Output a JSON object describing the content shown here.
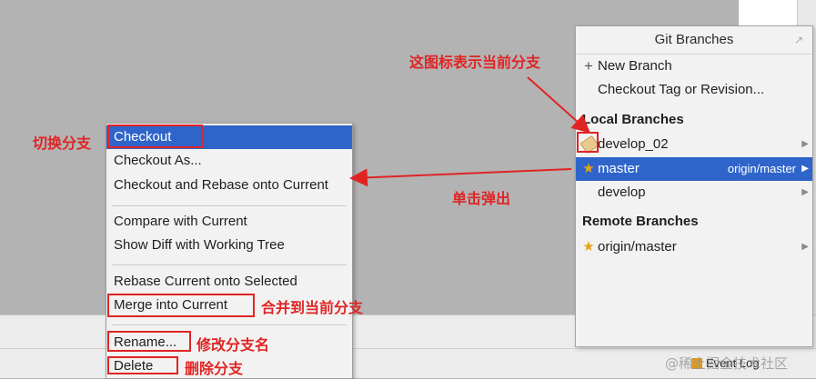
{
  "context_menu": {
    "items": [
      {
        "label": "Checkout"
      },
      {
        "label": "Checkout As..."
      },
      {
        "label": "Checkout and Rebase onto Current"
      },
      {
        "label": "Compare with Current"
      },
      {
        "label": "Show Diff with Working Tree"
      },
      {
        "label": "Rebase Current onto Selected"
      },
      {
        "label": "Merge into Current"
      },
      {
        "label": "Rename..."
      },
      {
        "label": "Delete"
      }
    ]
  },
  "git_branches": {
    "title": "Git Branches",
    "new_branch": "New Branch",
    "checkout_tag": "Checkout Tag or Revision...",
    "local_header": "Local Branches",
    "local": [
      {
        "name": "develop_02",
        "icon": "tag-icon"
      },
      {
        "name": "master",
        "icon": "star-icon",
        "tracking": "origin/master"
      },
      {
        "name": "develop"
      }
    ],
    "remote_header": "Remote Branches",
    "remote": [
      {
        "name": "origin/master",
        "icon": "star-icon"
      }
    ]
  },
  "annotations": {
    "icon_current": "这图标表示当前分支",
    "switch": "切换分支",
    "click_popup": "单击弹出",
    "merge": "合并到当前分支",
    "rename": "修改分支名",
    "delete": "删除分支"
  },
  "status_bar": {
    "event_log": "Event Log",
    "watermark": "@稀土掘金技术社区"
  },
  "colors": {
    "selection": "#2f65ca",
    "annotation": "#e02424",
    "star": "#e8a416"
  }
}
